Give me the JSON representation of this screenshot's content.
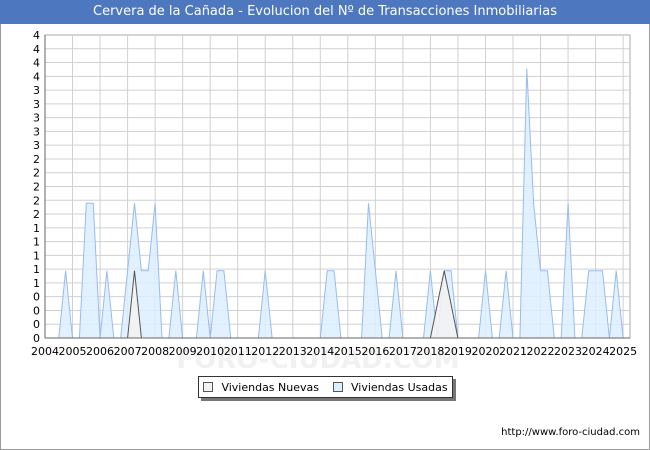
{
  "title": "Cervera de la Cañada - Evolucion del Nº de Transacciones Inmobiliarias",
  "source": "http://www.foro-ciudad.com",
  "watermark": "FORO-CIUDAD.COM",
  "colors": {
    "title_bg": "#4d78bf",
    "nuevas_fill": "#f2f2f2",
    "nuevas_line": "#555555",
    "usadas_fill": "#ddeeff",
    "usadas_line": "#99bbee",
    "grid": "#d0d0d0"
  },
  "chart_data": {
    "type": "area",
    "title": "Cervera de la Cañada - Evolucion del Nº de Transacciones Inmobiliarias",
    "xlabel": "",
    "ylabel": "",
    "x_tick_labels": [
      "2004",
      "2005",
      "2006",
      "2007",
      "2008",
      "2009",
      "2010",
      "2011",
      "2012",
      "2013",
      "2014",
      "2015",
      "2016",
      "2017",
      "2018",
      "2019",
      "2020",
      "2021",
      "2022",
      "2023",
      "2024",
      "2025"
    ],
    "y_tick_labels": [
      "0",
      "0",
      "0",
      "0",
      "1",
      "1",
      "1",
      "1",
      "1",
      "2",
      "2",
      "2",
      "2",
      "2",
      "3",
      "3",
      "3",
      "3",
      "3",
      "4",
      "4",
      "4",
      "4"
    ],
    "ylim": [
      0,
      4.5
    ],
    "xlim": [
      2004,
      2025.25
    ],
    "grid": true,
    "legend_position": "bottom",
    "series": [
      {
        "name": "Viviendas Nuevas",
        "points": [
          [
            2004.75,
            0
          ],
          [
            2007,
            0
          ],
          [
            2007.25,
            1
          ],
          [
            2007.5,
            0
          ],
          [
            2018,
            0
          ],
          [
            2018.5,
            1
          ],
          [
            2019,
            0
          ],
          [
            2024.75,
            0
          ]
        ]
      },
      {
        "name": "Viviendas Usadas",
        "points": [
          [
            2004.5,
            0
          ],
          [
            2004.75,
            1
          ],
          [
            2005,
            0
          ],
          [
            2005.25,
            0
          ],
          [
            2005.5,
            2
          ],
          [
            2005.75,
            2
          ],
          [
            2006,
            0
          ],
          [
            2006.25,
            1
          ],
          [
            2006.5,
            0
          ],
          [
            2006.75,
            0
          ],
          [
            2007,
            1
          ],
          [
            2007.25,
            2
          ],
          [
            2007.5,
            1
          ],
          [
            2007.75,
            1
          ],
          [
            2008,
            2
          ],
          [
            2008.25,
            0
          ],
          [
            2008.5,
            0
          ],
          [
            2008.75,
            1
          ],
          [
            2009,
            0
          ],
          [
            2009.5,
            0
          ],
          [
            2009.75,
            1
          ],
          [
            2010,
            0
          ],
          [
            2010.25,
            1
          ],
          [
            2010.5,
            1
          ],
          [
            2010.75,
            0
          ],
          [
            2011.75,
            0
          ],
          [
            2012,
            1
          ],
          [
            2012.25,
            0
          ],
          [
            2014,
            0
          ],
          [
            2014.25,
            1
          ],
          [
            2014.5,
            1
          ],
          [
            2014.75,
            0
          ],
          [
            2015.5,
            0
          ],
          [
            2015.75,
            2
          ],
          [
            2016,
            1
          ],
          [
            2016.25,
            0
          ],
          [
            2016.5,
            0
          ],
          [
            2016.75,
            1
          ],
          [
            2017,
            0
          ],
          [
            2017.75,
            0
          ],
          [
            2018,
            1
          ],
          [
            2018.25,
            0
          ],
          [
            2018.5,
            1
          ],
          [
            2018.75,
            1
          ],
          [
            2019,
            0
          ],
          [
            2019.75,
            0
          ],
          [
            2020,
            1
          ],
          [
            2020.25,
            0
          ],
          [
            2020.5,
            0
          ],
          [
            2020.75,
            1
          ],
          [
            2021,
            0
          ],
          [
            2021.25,
            0
          ],
          [
            2021.5,
            4
          ],
          [
            2021.75,
            2
          ],
          [
            2022,
            1
          ],
          [
            2022.25,
            1
          ],
          [
            2022.5,
            0
          ],
          [
            2022.75,
            0
          ],
          [
            2023,
            2
          ],
          [
            2023.25,
            0
          ],
          [
            2023.5,
            0
          ],
          [
            2023.75,
            1
          ],
          [
            2024,
            1
          ],
          [
            2024.25,
            1
          ],
          [
            2024.5,
            0
          ],
          [
            2024.75,
            1
          ],
          [
            2025,
            0
          ]
        ]
      }
    ]
  },
  "legend": {
    "items": [
      {
        "label": "Viviendas Nuevas"
      },
      {
        "label": "Viviendas Usadas"
      }
    ]
  }
}
